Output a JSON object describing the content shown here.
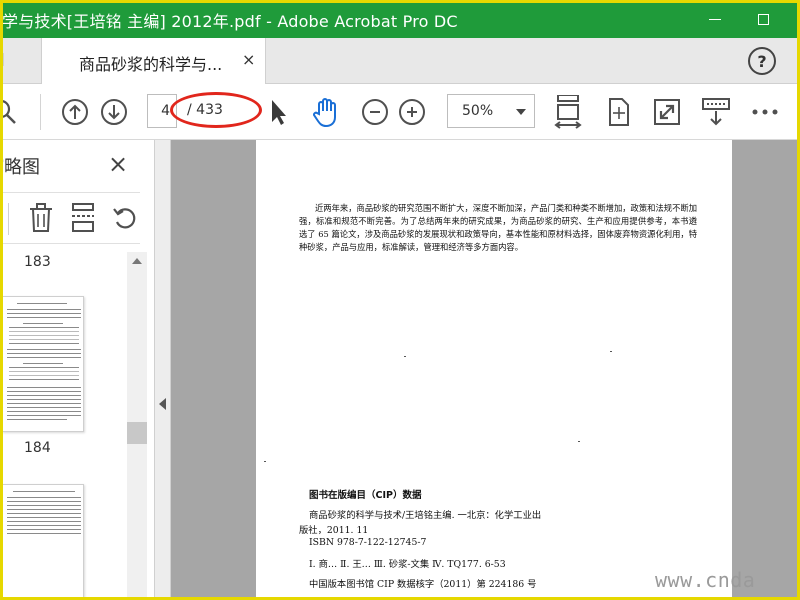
{
  "window": {
    "title": "学与技术[王培铭 主编] 2012年.pdf - Adobe Acrobat Pro DC"
  },
  "tabs": {
    "left_partial": "l",
    "active_label": "商品砂浆的科学与...",
    "close_glyph": "×"
  },
  "toolbar": {
    "help_label": "?",
    "current_page": "4",
    "total_pages": "/ 433",
    "zoom_value": "50%"
  },
  "thumbnails_panel": {
    "title": "缩略图",
    "close_glyph": "×",
    "page_labels": [
      "183",
      "184"
    ]
  },
  "document": {
    "intro_text": "近两年来，商品砂浆的研究范围不断扩大，深度不断加深，产品门类和种类不断增加，政策和法规不断加强，标准和规范不断完善。为了总结两年来的研究成果，为商品砂浆的研究、生产和应用提供参考，本书遴选了 65 篇论文，涉及商品砂浆的发展现状和政策导向，基本性能和原材料选择，固体废弃物资源化利用，特种砂浆，产品与应用，标准解读，管理和经济等多方面内容。",
    "cip_title": "图书在版编目（CIP）数据",
    "cip_lines": [
      "商品砂浆的科学与技术/王培铭主编. 一北京：化学工业出",
      "版社，2011. 11",
      "ISBN 978-7-122-12745-7",
      "Ⅰ. 商…   Ⅱ. 王…   Ⅲ. 砂浆-文集   Ⅳ. TQ177. 6-53",
      "中国版本图书馆 CIP 数据核字（2011）第 224186 号"
    ]
  },
  "watermark": "www.cnda",
  "colors": {
    "titlebar": "#1f9b3a",
    "frame": "#e6d800",
    "annotation_ellipse": "#e1261c",
    "hand_tool": "#1a6fd6"
  },
  "icons": [
    "search-icon",
    "arrow-up-icon",
    "arrow-down-icon",
    "select-cursor-icon",
    "hand-icon",
    "zoom-out-icon",
    "zoom-in-icon",
    "fit-page-icon",
    "rotate-view-icon",
    "fullscreen-icon",
    "read-mode-icon",
    "more-icon",
    "trash-icon",
    "extract-pages-icon",
    "undo-icon"
  ]
}
